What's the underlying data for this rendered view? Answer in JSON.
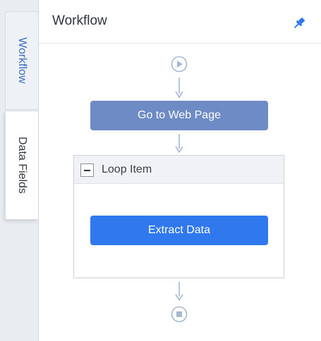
{
  "sidebar": {
    "tabs": [
      {
        "label": "Workflow",
        "active": true
      },
      {
        "label": "Data Fields",
        "active": false
      }
    ]
  },
  "panel": {
    "title": "Workflow",
    "pin_icon": "pin-icon"
  },
  "workflow": {
    "start_icon": "play-circle-icon",
    "end_icon": "stop-circle-icon",
    "steps": {
      "go_to_web_page": "Go to Web Page",
      "loop_item": "Loop Item",
      "extract_data": "Extract Data"
    }
  },
  "colors": {
    "accent": "#2f78ee",
    "step_muted": "#6e8bc5",
    "connector": "#9fb2d2",
    "active_tab_text": "#3d6fc6"
  }
}
